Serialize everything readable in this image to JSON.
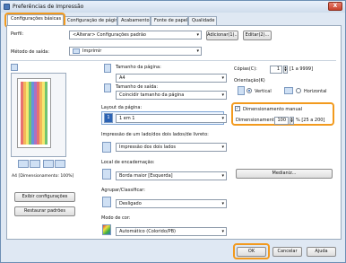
{
  "window": {
    "title": "Preferências de Impressão",
    "close_glyph": "X"
  },
  "tabs": [
    "Configurações básicas",
    "Configuração de página",
    "Acabamento",
    "Fonte de papel",
    "Qualidade"
  ],
  "profile": {
    "label": "Perfil:",
    "value": "<Alterar> Configurações padrão",
    "add_button": "Adicionar(1)...",
    "edit_button": "Editar(2)..."
  },
  "output": {
    "label": "Método de saída:",
    "value": "Imprimir"
  },
  "preview": {
    "status": "A4 [Dimensionamento: 100%]"
  },
  "left_buttons": {
    "view_settings": "Exibir configurações",
    "restore_defaults": "Restaurar padrões"
  },
  "page_size": {
    "label": "Tamanho da página:",
    "value": "A4"
  },
  "output_size": {
    "label": "Tamanho de saída:",
    "value": "Coincidir tamanho da página"
  },
  "copies": {
    "label": "Cópias(C):",
    "value": "1",
    "range": "[1 a 9999]"
  },
  "orientation": {
    "label": "Orientação(K)",
    "portrait": "Vertical",
    "landscape": "Horizontal",
    "selected": "portrait"
  },
  "layout": {
    "label": "Layout da página:",
    "value": "1 em 1",
    "icon_number": "1"
  },
  "manual_scaling": {
    "label": "Dimensionamento manual",
    "checked": true,
    "scale_label": "Dimensionamento:",
    "value": "100",
    "range": "% [25 a 200]"
  },
  "duplex": {
    "label": "Impressão de um lado/dos dois lados/de livreto:",
    "value": "Impressão dos dois lados"
  },
  "binding": {
    "label": "Local de encadernação:",
    "value": "Borda maior [Esquerda]",
    "gutter_button": "Medianiz..."
  },
  "collate": {
    "label": "Agrupar/Classificar:",
    "value": "Desligado"
  },
  "color_mode": {
    "label": "Modo de cor:",
    "value": "Automático (Colorido/PB)"
  },
  "footer": {
    "ok": "OK",
    "cancel": "Cancelar",
    "help": "Ajuda"
  },
  "colors": {
    "highlight": "#f29a1e",
    "accent": "#2b62b4"
  }
}
